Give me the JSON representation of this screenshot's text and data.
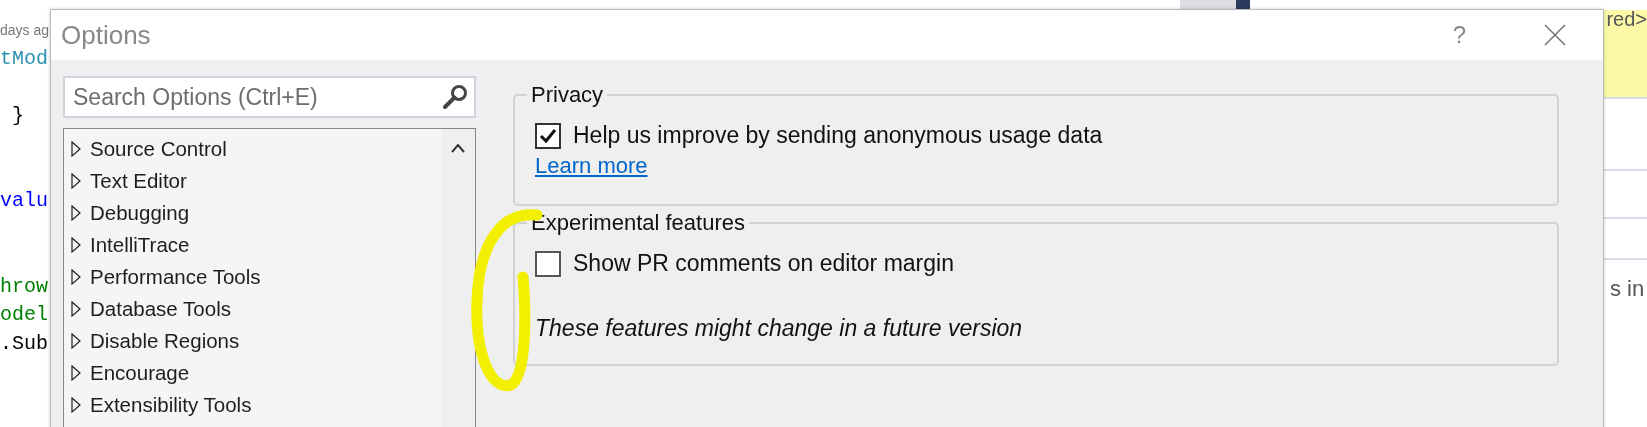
{
  "editor": {
    "lines": [
      {
        "kind": "comment",
        "text": "days ag"
      },
      {
        "kind": "type",
        "text": "tMod"
      },
      {
        "kind": "blank"
      },
      {
        "kind": "plain",
        "text": " }"
      },
      {
        "kind": "blank"
      },
      {
        "kind": "blank"
      },
      {
        "kind": "keyword",
        "text": "valu"
      },
      {
        "kind": "blank"
      },
      {
        "kind": "blank"
      },
      {
        "kind": "string",
        "text": "hrow"
      },
      {
        "kind": "string",
        "text": "odel"
      },
      {
        "kind": "plain",
        "text": ".Sub"
      }
    ]
  },
  "side_panel": {
    "commit_text": "red>",
    "text": "s in"
  },
  "dialog": {
    "title": "Options",
    "help": "?",
    "search": {
      "placeholder": "Search Options (Ctrl+E)"
    },
    "tree": {
      "items": [
        {
          "label": "Source Control",
          "expanded": false
        },
        {
          "label": "Text Editor",
          "expanded": false
        },
        {
          "label": "Debugging",
          "expanded": false
        },
        {
          "label": "IntelliTrace",
          "expanded": false
        },
        {
          "label": "Performance Tools",
          "expanded": false
        },
        {
          "label": "Database Tools",
          "expanded": false
        },
        {
          "label": "Disable Regions",
          "expanded": false
        },
        {
          "label": "Encourage",
          "expanded": false
        },
        {
          "label": "Extensibility Tools",
          "expanded": false
        }
      ]
    },
    "groups": [
      {
        "title": "Privacy",
        "options": [
          {
            "kind": "checkbox",
            "label": "Help us improve by sending anonymous usage data",
            "checked": true
          },
          {
            "kind": "link",
            "label": "Learn more"
          }
        ]
      },
      {
        "title": "Experimental features",
        "options": [
          {
            "kind": "checkbox",
            "label": "Show PR comments on editor margin",
            "checked": false
          },
          {
            "kind": "note",
            "label": "These features might change in a future version"
          }
        ]
      }
    ]
  },
  "annotation": {
    "kind": "ellipse",
    "color": "#f2f000"
  }
}
